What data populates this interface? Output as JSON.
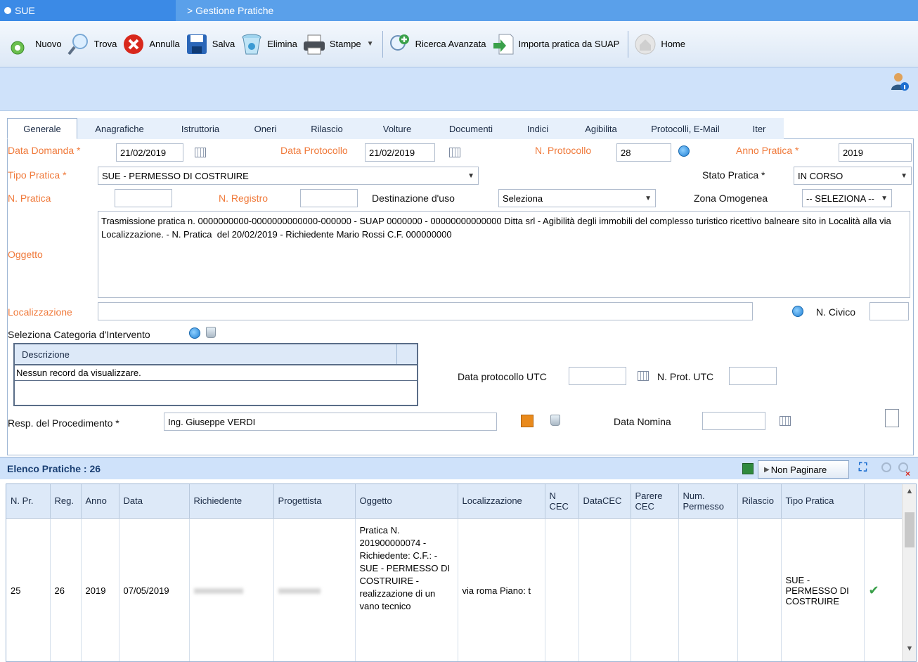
{
  "titlebar": {
    "app": "SUE",
    "breadcrumb": "> Gestione Pratiche"
  },
  "toolbar": {
    "nuovo": "Nuovo",
    "trova": "Trova",
    "annulla": "Annulla",
    "salva": "Salva",
    "elimina": "Elimina",
    "stampe": "Stampe",
    "ricerca": "Ricerca Avanzata",
    "importa": "Importa pratica da SUAP",
    "home": "Home"
  },
  "tabs": [
    "Generale",
    "Anagrafiche",
    "Istruttoria",
    "Oneri",
    "Rilascio",
    "Volture",
    "Documenti",
    "Indici",
    "Agibilita",
    "Protocolli, E-Mail",
    "Iter"
  ],
  "form": {
    "data_domanda_label": "Data Domanda *",
    "data_domanda": "21/02/2019",
    "data_protocollo_label": "Data Protocollo",
    "data_protocollo": "21/02/2019",
    "n_protocollo_label": "N. Protocollo",
    "n_protocollo": "28",
    "anno_pratica_label": "Anno Pratica *",
    "anno_pratica": "2019",
    "tipo_pratica_label": "Tipo Pratica *",
    "tipo_pratica": "SUE - PERMESSO DI COSTRUIRE",
    "stato_pratica_label": "Stato Pratica *",
    "stato_pratica": "IN CORSO",
    "n_pratica_label": "N. Pratica",
    "n_registro_label": "N. Registro",
    "destinazione_label": "Destinazione d'uso",
    "destinazione": "Seleziona",
    "zona_label": "Zona Omogenea",
    "zona": "-- SELEZIONA --",
    "oggetto_label": "Oggetto",
    "oggetto": "Trasmissione pratica n. 0000000000-0000000000000-000000 - SUAP 0000000 - 00000000000000 Ditta srl - Agibilità degli immobili del complesso turistico ricettivo balneare sito in Località alla via Localizzazione. - N. Pratica  del 20/02/2019 - Richiedente Mario Rossi C.F. 000000000",
    "localizzazione_label": "Localizzazione",
    "n_civico_label": "N. Civico",
    "categoria_label": "Seleziona Categoria d'Intervento",
    "subgrid_header": "Descrizione",
    "subgrid_empty": "Nessun record da visualizzare.",
    "data_prot_utc_label": "Data protocollo UTC",
    "n_prot_utc_label": "N. Prot. UTC",
    "resp_label": "Resp. del Procedimento *",
    "resp": "Ing. Giuseppe VERDI",
    "data_nomina_label": "Data Nomina"
  },
  "list": {
    "title": "Elenco Pratiche : 26",
    "non_paginare": "Non Paginare",
    "columns": [
      "N. Pr.",
      "Reg.",
      "Anno",
      "Data",
      "Richiedente",
      "Progettista",
      "Oggetto",
      "Localizzazione",
      "N CEC",
      "DataCEC",
      "Parere CEC",
      "Num. Permesso",
      "Rilascio",
      "Tipo Pratica",
      ""
    ],
    "rows": [
      {
        "n_pr": "25",
        "reg": "26",
        "anno": "2019",
        "data": "07/05/2019",
        "richiedente": "",
        "progettista": "",
        "oggetto": "Pratica N. 201900000074 - Richiedente: C.F.: - SUE - PERMESSO DI COSTRUIRE - realizzazione di un vano tecnico",
        "localizzazione": "via roma Piano: t",
        "tipo": "SUE - PERMESSO DI COSTRUIRE"
      }
    ]
  }
}
